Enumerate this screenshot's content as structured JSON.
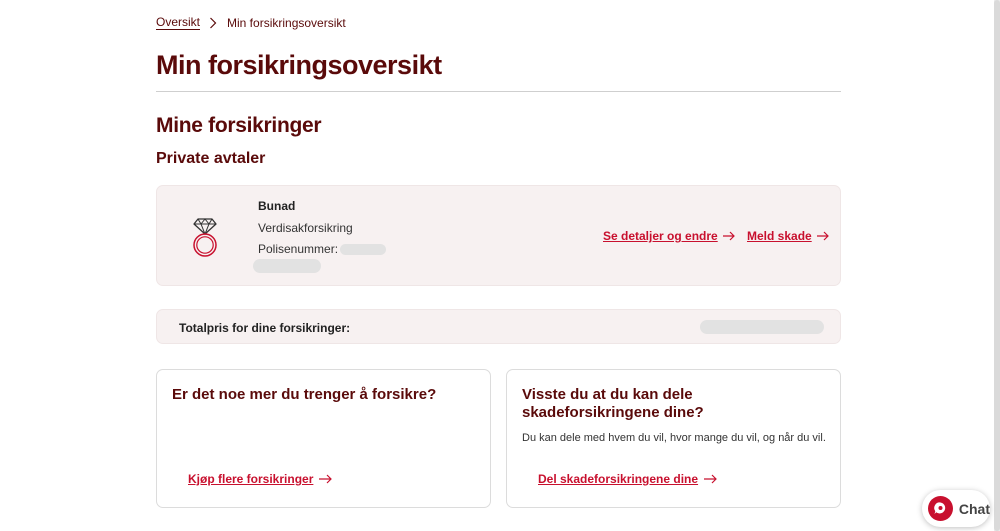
{
  "breadcrumb": {
    "home": "Oversikt",
    "current": "Min forsikringsoversikt"
  },
  "page": {
    "title": "Min forsikringsoversikt"
  },
  "section": {
    "title": "Mine forsikringer",
    "subtitle": "Private avtaler"
  },
  "policy": {
    "icon": "ring-icon",
    "name": "Bunad",
    "type": "Verdisakforsikring",
    "number_label": "Polisenummer:",
    "details_label": "Se detaljer og endre",
    "claim_label": "Meld skade"
  },
  "total": {
    "label": "Totalpris for dine forsikringer:"
  },
  "cards": [
    {
      "title": "Er det noe mer du trenger å forsikre?",
      "body": "",
      "link": "Kjøp flere forsikringer"
    },
    {
      "title": "Visste du at du kan dele skadeforsikringene dine?",
      "body": "Du kan dele med hvem du vil, hvor mange du vil, og når du vil.",
      "link": "Del skadeforsikringene dine"
    }
  ],
  "chat": {
    "label": "Chat"
  },
  "colors": {
    "heading": "#5a0a0a",
    "accent": "#c8102e",
    "card_bg": "#f7f1f1"
  }
}
